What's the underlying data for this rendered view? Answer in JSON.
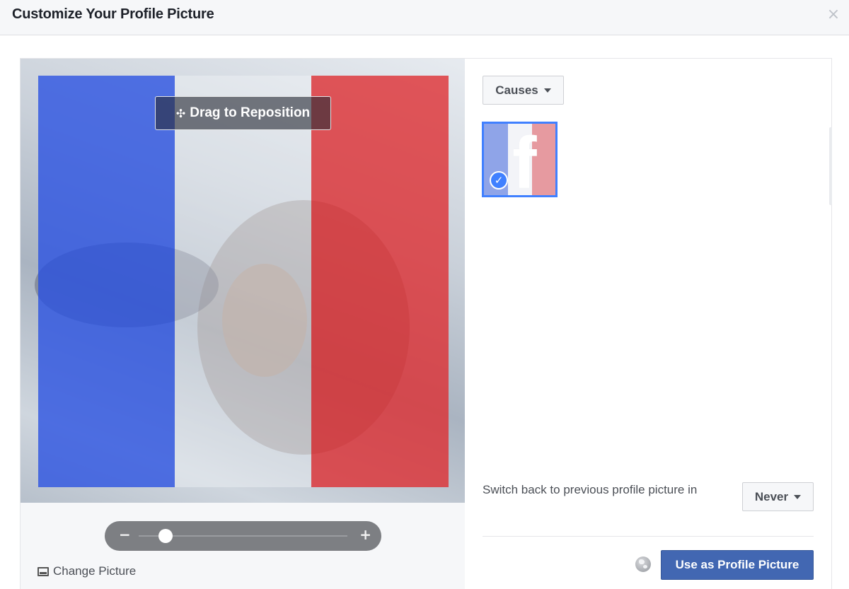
{
  "dialog": {
    "title": "Customize Your Profile Picture",
    "close_glyph": "×"
  },
  "editor": {
    "drag_label": "Drag to Reposition",
    "move_glyph": "✣",
    "zoom": {
      "minus_glyph": "−",
      "plus_glyph": "+",
      "level": 0.13
    },
    "change_picture_label": "Change Picture",
    "overlay_colors": [
      "#2850e1",
      "#f5f6fa",
      "#de2a2e"
    ]
  },
  "frames": {
    "category_label": "Causes",
    "selected_frame": {
      "icon": "facebook-f-flag-frame",
      "letter": "f",
      "check_glyph": "✓"
    }
  },
  "footer": {
    "switch_back_label": "Switch back to previous profile picture in",
    "switch_back_value": "Never",
    "privacy_icon": "globe-icon",
    "submit_label": "Use as Profile Picture",
    "accent_color": "#4267b2"
  }
}
